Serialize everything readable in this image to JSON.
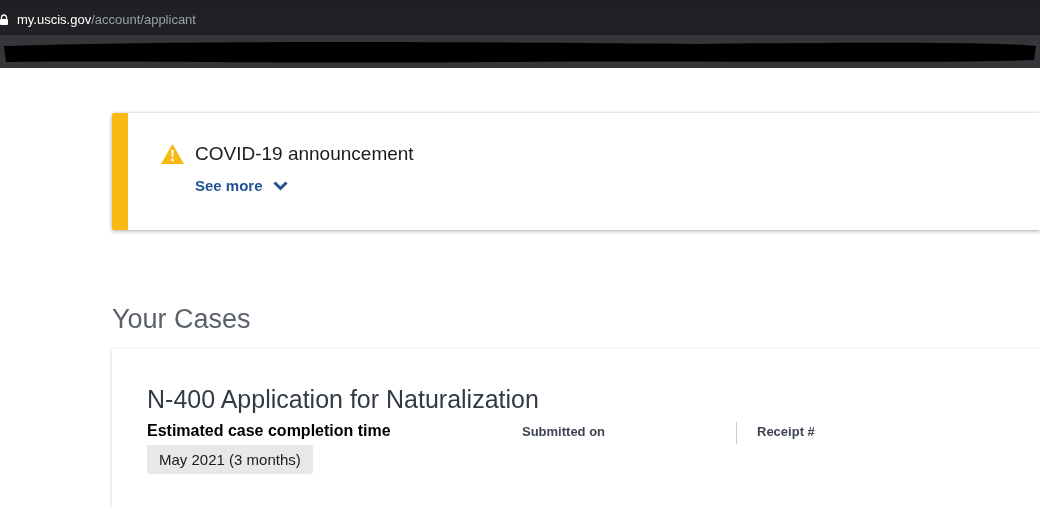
{
  "browser": {
    "address": {
      "host": "my.uscis.gov",
      "path": "/account/applicant"
    }
  },
  "alert": {
    "title": "COVID-19 announcement",
    "link": "See more"
  },
  "cases_heading": "Your Cases",
  "case": {
    "title": "N-400 Application for Naturalization",
    "estimate_label": "Estimated case completion time",
    "estimate_value": "May 2021 (3 months)",
    "fields": [
      {
        "label": "Submitted on"
      },
      {
        "label": "Receipt #"
      }
    ]
  }
}
